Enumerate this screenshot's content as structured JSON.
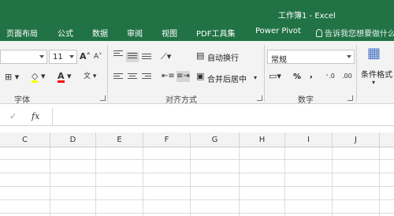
{
  "window": {
    "title": "工作簿1 - Excel"
  },
  "tabs": [
    {
      "label": "页面布局"
    },
    {
      "label": "公式"
    },
    {
      "label": "数据"
    },
    {
      "label": "审阅"
    },
    {
      "label": "视图"
    },
    {
      "label": "PDF工具集"
    },
    {
      "label": "Power Pivot"
    }
  ],
  "tell_me": "告诉我您想要做什么",
  "font_group": {
    "size_value": "11",
    "increase_icon": "A˄",
    "decrease_icon": "A˅",
    "label": "字体"
  },
  "alignment_group": {
    "wrap_text": "自动换行",
    "merge_center": "合并后居中",
    "label": "对齐方式"
  },
  "number_group": {
    "format_value": "常规",
    "percent": "%",
    "comma": ",",
    "label": "数字"
  },
  "styles_group": {
    "conditional_format": "条件格式"
  },
  "formula_bar": {
    "fx": "fx",
    "value": ""
  },
  "columns": [
    "C",
    "D",
    "E",
    "F",
    "G",
    "H",
    "I",
    "J"
  ],
  "colors": {
    "excel_green": "#217346",
    "highlight_yellow": "#ffff00",
    "font_red": "#ff0000"
  }
}
